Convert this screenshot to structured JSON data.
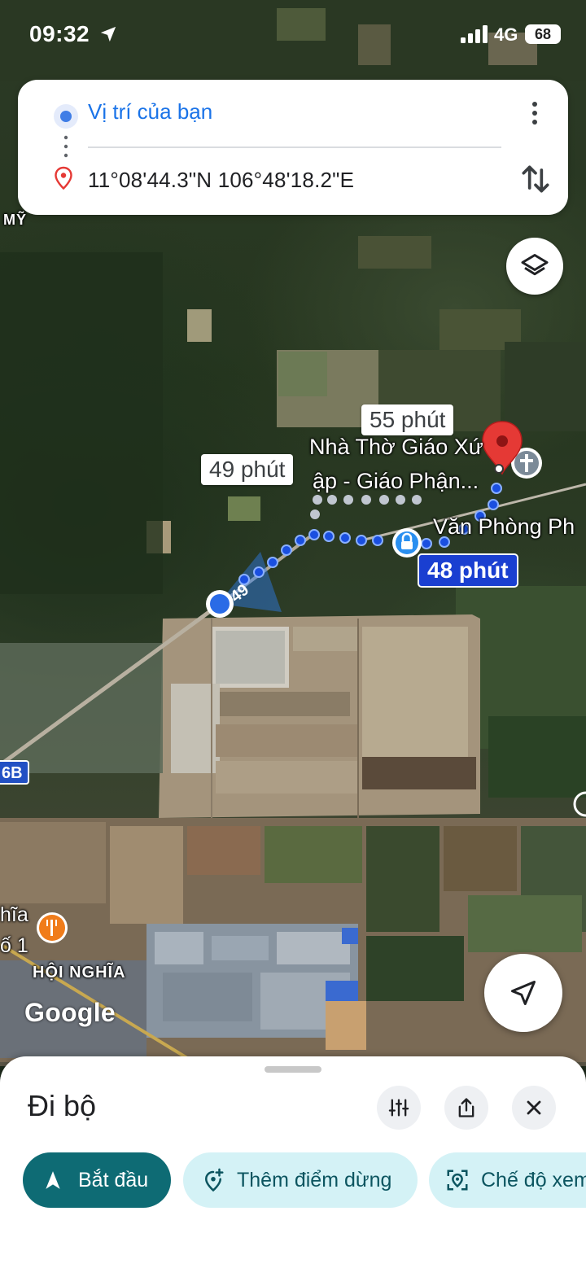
{
  "status_bar": {
    "time": "09:32",
    "network": "4G",
    "battery": "68"
  },
  "route": {
    "origin": "Vị trí của bạn",
    "destination": "11°08'44.3\"N 106°48'18.2\"E"
  },
  "map": {
    "labels": {
      "my": "MỸ",
      "church_line1": "Nhà Thờ Giáo Xứ",
      "church_line2": "ập - Giáo Phận...",
      "office": "Văn Phòng Ph",
      "hoi_nghia": "HỘI NGHĨA",
      "nghia": "hĩa",
      "so1": "ố 1",
      "road": "6B"
    },
    "route_times": {
      "alt1": "55 phút",
      "alt2": "49 phút",
      "main": "48 phút"
    },
    "road_marker": "49",
    "logo": "Google"
  },
  "bottom_sheet": {
    "mode": "Đi bộ",
    "start_label": "Bắt đầu",
    "add_stop_label": "Thêm điểm dừng",
    "preview_label": "Chế độ xem"
  },
  "icons": {
    "status": [
      "location-arrow-icon",
      "signal-icon",
      "battery-icon"
    ],
    "card": [
      "origin-dot-icon",
      "destination-pin-icon",
      "more-vert-icon",
      "swap-icon"
    ],
    "map": [
      "layers-icon",
      "navigation-arrow-icon",
      "church-icon",
      "lock-icon",
      "restaurant-icon",
      "destination-pin-icon"
    ],
    "sheet": [
      "tune-icon",
      "share-icon",
      "close-icon",
      "navigation-icon",
      "add-location-icon",
      "preview-location-icon"
    ]
  },
  "colors": {
    "route_blue": "#1a73e8",
    "primary_button": "#0e6b74",
    "chip_bg": "#d4f2f6",
    "pin_red": "#e53935"
  }
}
